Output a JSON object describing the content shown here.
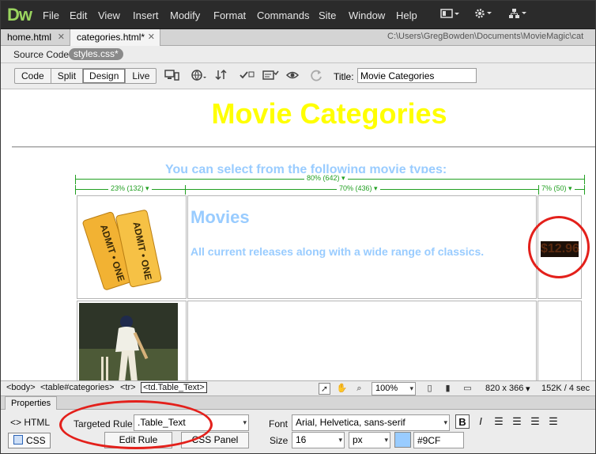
{
  "app": {
    "logo": "Dw",
    "menus": [
      "File",
      "Edit",
      "View",
      "Insert",
      "Modify",
      "Format",
      "Commands",
      "Site",
      "Window",
      "Help"
    ],
    "menu_icons": [
      "layout-icon",
      "gear-icon",
      "site-structure-icon"
    ]
  },
  "doc_tabs": [
    {
      "label": "home.html"
    },
    {
      "label": "categories.html*"
    }
  ],
  "doc_path": "C:\\Users\\GregBowden\\Documents\\MovieMagic\\cat",
  "related_files": {
    "source_code": "Source Code",
    "styles": "styles.css*"
  },
  "toolbar": {
    "views": [
      "Code",
      "Split",
      "Design",
      "Live"
    ],
    "active_view": "Design",
    "title_label": "Title:",
    "title_value": "Movie Categories"
  },
  "page": {
    "heading": "Movie Categories",
    "subheading": "You can select from the following movie types:",
    "table_width": "80% (642)",
    "col_widths": [
      "23% (132)",
      "70% (436)",
      "7% (50)"
    ],
    "row1": {
      "title": "Movies",
      "description": "All current releases along with a wide range of classics.",
      "price": "$12.96"
    },
    "colors": {
      "heading": "#ffff00",
      "text": "#99ccff",
      "guides": "#22a022",
      "callout": "#e3201b"
    }
  },
  "tag_selector": [
    "<body>",
    "<table#categories>",
    "<tr>",
    "<td.Table_Text>"
  ],
  "status": {
    "zoom": "100%",
    "window_size": "820 x 366",
    "file_info": "152K / 4 sec"
  },
  "properties": {
    "tab": "Properties",
    "html_label": "HTML",
    "css_label": "CSS",
    "targeted_rule_label": "Targeted Rule",
    "targeted_rule": ".Table_Text",
    "edit_rule": "Edit Rule",
    "css_panel": "CSS Panel",
    "font_label": "Font",
    "font_value": "Arial, Helvetica, sans-serif",
    "size_label": "Size",
    "size_value": "16",
    "size_unit": "px",
    "color_value": "#9CF"
  }
}
